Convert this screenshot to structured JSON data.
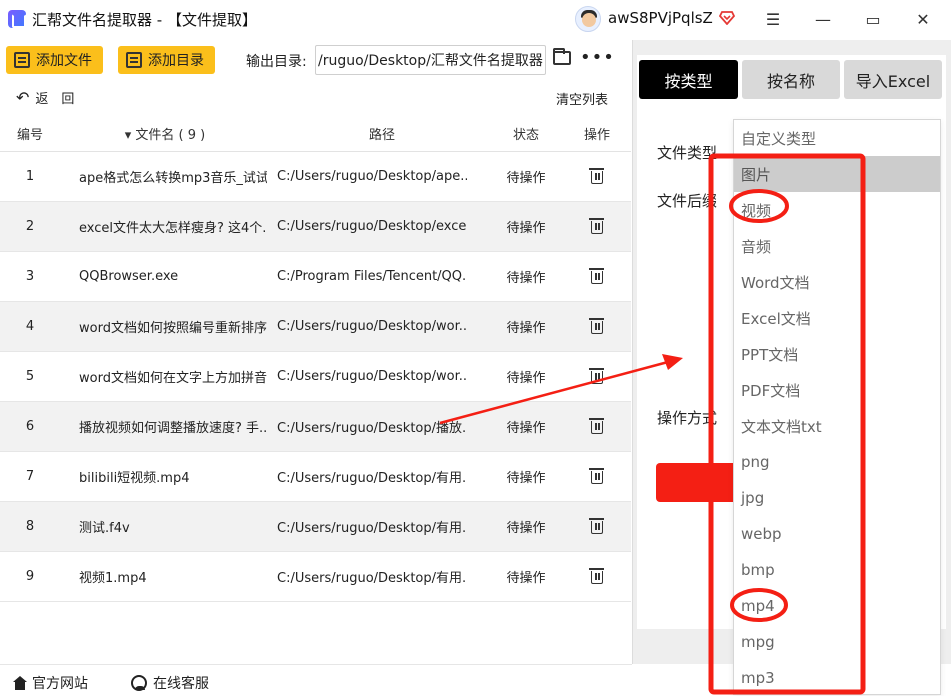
{
  "titlebar": {
    "title": "汇帮文件名提取器 - 【文件提取】",
    "username": "awS8PVjPqlsZ",
    "min_glyph": "—",
    "max_glyph": "▭",
    "close_glyph": "✕",
    "menu_glyph": "☰"
  },
  "toolbar": {
    "add_file": "添加文件",
    "add_dir": "添加目录",
    "output_label": "输出目录:",
    "output_value": "/ruguo/Desktop/汇帮文件名提取器",
    "more_glyph": "•••"
  },
  "list": {
    "back_label": "返　回",
    "clear_label": "清空列表",
    "headers": {
      "no": "编号",
      "name": "▾ 文件名 ( 9 )",
      "path": "路径",
      "status": "状态",
      "op": "操作"
    },
    "rows": [
      {
        "no": "1",
        "name": "ape格式怎么转换mp3音乐_试试...",
        "path": "C:/Users/ruguo/Desktop/ape...",
        "status": "待操作"
      },
      {
        "no": "2",
        "name": "excel文件太大怎样瘦身? 这4个...",
        "path": "C:/Users/ruguo/Desktop/excel...",
        "status": "待操作"
      },
      {
        "no": "3",
        "name": "QQBrowser.exe",
        "path": "C:/Program Files/Tencent/QQ...",
        "status": "待操作"
      },
      {
        "no": "4",
        "name": "word文档如何按照编号重新排序...",
        "path": "C:/Users/ruguo/Desktop/wor...",
        "status": "待操作"
      },
      {
        "no": "5",
        "name": "word文档如何在文字上方加拼音...",
        "path": "C:/Users/ruguo/Desktop/wor...",
        "status": "待操作"
      },
      {
        "no": "6",
        "name": "播放视频如何调整播放速度? 手...",
        "path": "C:/Users/ruguo/Desktop/播放...",
        "status": "待操作"
      },
      {
        "no": "7",
        "name": "bilibili短视频.mp4",
        "path": "C:/Users/ruguo/Desktop/有用...",
        "status": "待操作"
      },
      {
        "no": "8",
        "name": "测试.f4v",
        "path": "C:/Users/ruguo/Desktop/有用...",
        "status": "待操作"
      },
      {
        "no": "9",
        "name": "视频1.mp4",
        "path": "C:/Users/ruguo/Desktop/有用...",
        "status": "待操作"
      }
    ]
  },
  "right_panel": {
    "tabs": [
      "按类型",
      "按名称",
      "导入Excel"
    ],
    "active_tab": 0,
    "file_type_label": "文件类型",
    "file_ext_label": "文件后缀",
    "op_mode_label": "操作方式",
    "dropdown_options": [
      "自定义类型",
      "图片",
      "视频",
      "音频",
      "Word文档",
      "Excel文档",
      "PPT文档",
      "PDF文档",
      "文本文档txt",
      "png",
      "jpg",
      "webp",
      "bmp",
      "mp4",
      "mpg",
      "mp3"
    ],
    "hovered_option": 1
  },
  "footer": {
    "website": "官方网站",
    "service": "在线客服"
  },
  "colors": {
    "accent_yellow": "#fbbf1b",
    "annotation_red": "#f41f14",
    "tab_active": "#000000"
  }
}
